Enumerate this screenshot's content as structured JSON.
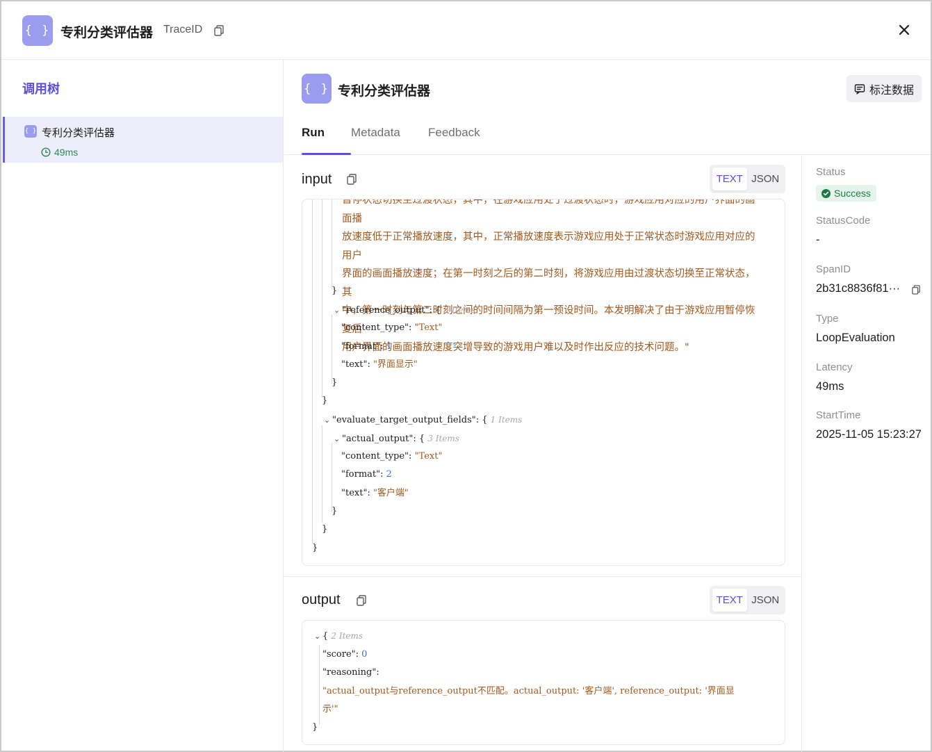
{
  "header": {
    "icon_text": "{ }",
    "title": "专利分类评估器",
    "trace_label": "TraceID"
  },
  "tree": {
    "title": "调用树",
    "nodes": [
      {
        "icon_text": "{ }",
        "label": "专利分类评估器",
        "latency": "49ms"
      }
    ]
  },
  "span": {
    "icon_text": "{ }",
    "title": "专利分类评估器",
    "annotate_label": "标注数据",
    "tabs": [
      "Run",
      "Metadata",
      "Feedback"
    ],
    "active_tab": "Run"
  },
  "input": {
    "title": "input",
    "view_modes": [
      "TEXT",
      "JSON"
    ],
    "active_mode": "TEXT",
    "paragraph": [
      "暂停状态切换至过渡状态，其中，在游戏应用处于过渡状态时，游戏应用对应的用户界面的画面播",
      "放速度低于正常播放速度，其中，正常播放速度表示游戏应用处于正常状态时游戏应用对应的用户",
      "界面的画面播放速度；在第一时刻之后的第二时刻，将游戏应用由过渡状态切换至正常状态，其",
      "中，第一时刻与第二时刻之间的时间间隔为第一预设时间。本发明解决了由于游戏应用暂停恢复后",
      "用户界面的画面播放速度突增导致的游戏用户难以及时作出反应的技术问题。\""
    ],
    "reference_output": {
      "key": "\"reference_output\"",
      "count": "3 Items",
      "content_type_key": "\"content_type\"",
      "content_type": "\"Text\"",
      "format_key": "\"format\"",
      "format": "1",
      "text_key": "\"text\"",
      "text": "\"界面显示\""
    },
    "evaluate_target_output_fields": {
      "key": "\"evaluate_target_output_fields\"",
      "count": "1 Items",
      "actual_output_key": "\"actual_output\"",
      "actual_count": "3 Items",
      "content_type_key": "\"content_type\"",
      "content_type": "\"Text\"",
      "format_key": "\"format\"",
      "format": "2",
      "text_key": "\"text\"",
      "text": "\"客户端\""
    }
  },
  "output": {
    "title": "output",
    "view_modes": [
      "TEXT",
      "JSON"
    ],
    "active_mode": "TEXT",
    "count": "2 Items",
    "score_key": "\"score\"",
    "score": "0",
    "reasoning_key": "\"reasoning\"",
    "reasoning_line1": "\"actual_output与reference_output不匹配。actual_output: '客户端', reference_output: '界面显",
    "reasoning_line2": "示'\""
  },
  "info": {
    "status_label": "Status",
    "status_value": "Success",
    "status_code_label": "StatusCode",
    "status_code_value": "-",
    "span_id_label": "SpanID",
    "span_id_value": "2b31c8836f81···",
    "type_label": "Type",
    "type_value": "LoopEvaluation",
    "latency_label": "Latency",
    "latency_value": "49ms",
    "start_time_label": "StartTime",
    "start_time_value": "2025-11-05 15:23:27"
  },
  "colors": {
    "accent": "#5b4fe0",
    "icon_bg": "#9a9cf0",
    "string": "#a3581c",
    "number": "#3b6fd8",
    "success": "#1f7a44"
  },
  "icons": [
    "braces-icon",
    "copy-icon",
    "close-icon",
    "clock-icon",
    "annotate-icon",
    "check-circle-icon",
    "chevron-down-icon"
  ]
}
